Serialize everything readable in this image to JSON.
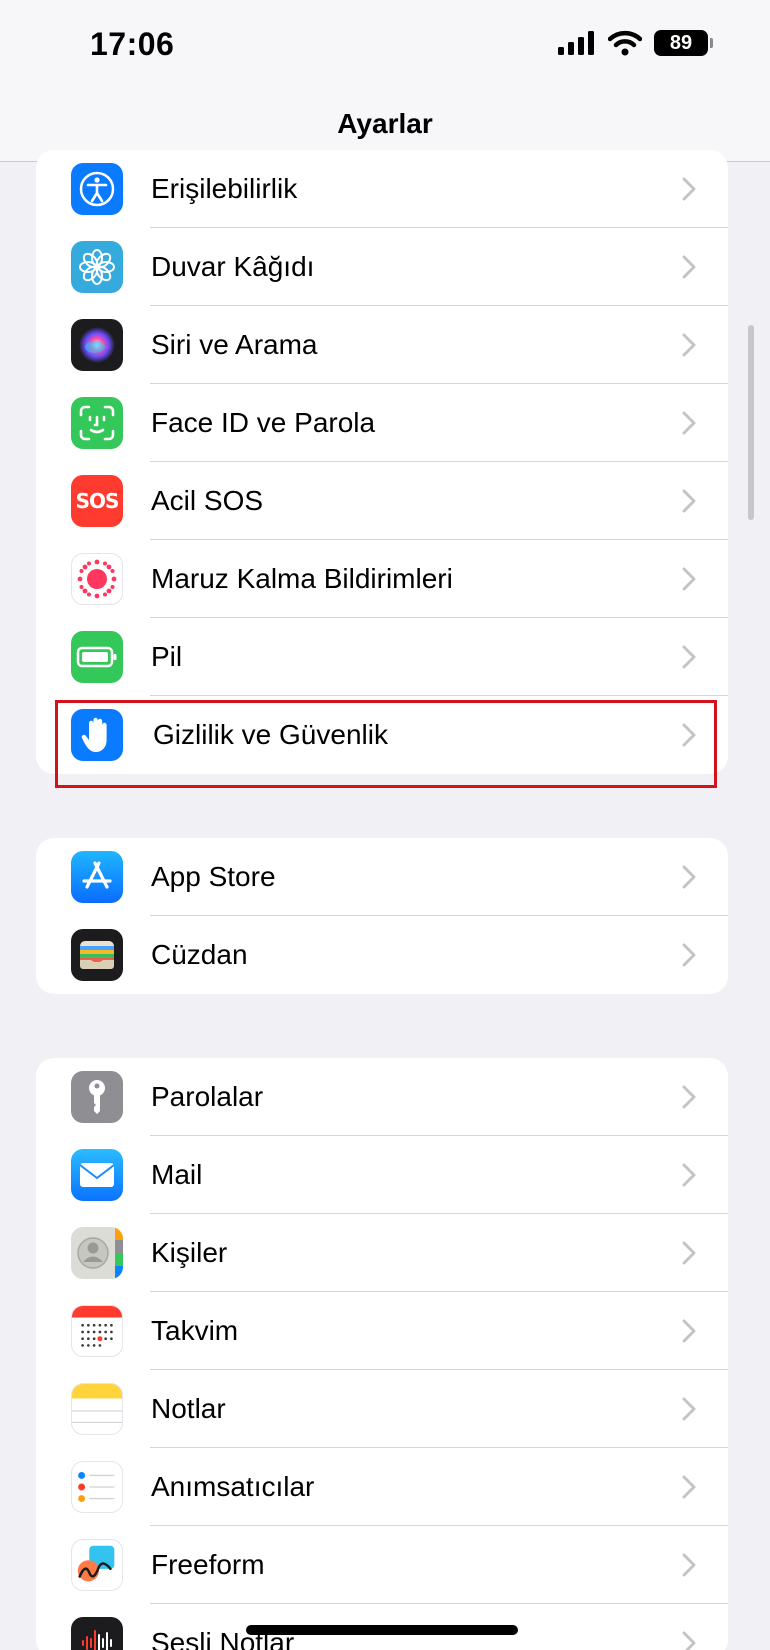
{
  "status": {
    "time": "17:06",
    "battery": "89"
  },
  "nav": {
    "title": "Ayarlar"
  },
  "groups": [
    {
      "items": [
        {
          "label": "Erişilebilirlik",
          "icon": "accessibility-icon",
          "color": "#0a7aff"
        },
        {
          "label": "Duvar Kâğıdı",
          "icon": "wallpaper-flower-icon",
          "color": "#35aadc"
        },
        {
          "label": "Siri ve Arama",
          "icon": "siri-icon",
          "color": "#1c1c1e"
        },
        {
          "label": "Face ID ve Parola",
          "icon": "face-id-icon",
          "color": "#34c759"
        },
        {
          "label": "Acil SOS",
          "icon": "sos-icon",
          "color": "#ff3b30",
          "icon_text": "SOS"
        },
        {
          "label": "Maruz Kalma Bildirimleri",
          "icon": "exposure-notifications-icon",
          "color": "#ff375f"
        },
        {
          "label": "Pil",
          "icon": "battery-icon",
          "color": "#34c759"
        },
        {
          "label": "Gizlilik ve Güvenlik",
          "icon": "privacy-hand-icon",
          "color": "#0a7aff",
          "highlighted": true
        }
      ]
    },
    {
      "items": [
        {
          "label": "App Store",
          "icon": "app-store-icon",
          "color": "#1a8cff"
        },
        {
          "label": "Cüzdan",
          "icon": "wallet-icon",
          "color": "#1c1c1e"
        }
      ]
    },
    {
      "items": [
        {
          "label": "Parolalar",
          "icon": "key-icon",
          "color": "#8e8e93"
        },
        {
          "label": "Mail",
          "icon": "mail-icon",
          "color": "#1a8cff"
        },
        {
          "label": "Kişiler",
          "icon": "contacts-icon",
          "color": "#d9d9d4"
        },
        {
          "label": "Takvim",
          "icon": "calendar-icon",
          "color": "#ffffff"
        },
        {
          "label": "Notlar",
          "icon": "notes-icon",
          "color": "#ffffff"
        },
        {
          "label": "Anımsatıcılar",
          "icon": "reminders-icon",
          "color": "#ffffff"
        },
        {
          "label": "Freeform",
          "icon": "freeform-icon",
          "color": "#ffffff"
        },
        {
          "label": "Sesli Notlar",
          "icon": "voice-memos-icon",
          "color": "#1c1c1e"
        }
      ]
    }
  ]
}
